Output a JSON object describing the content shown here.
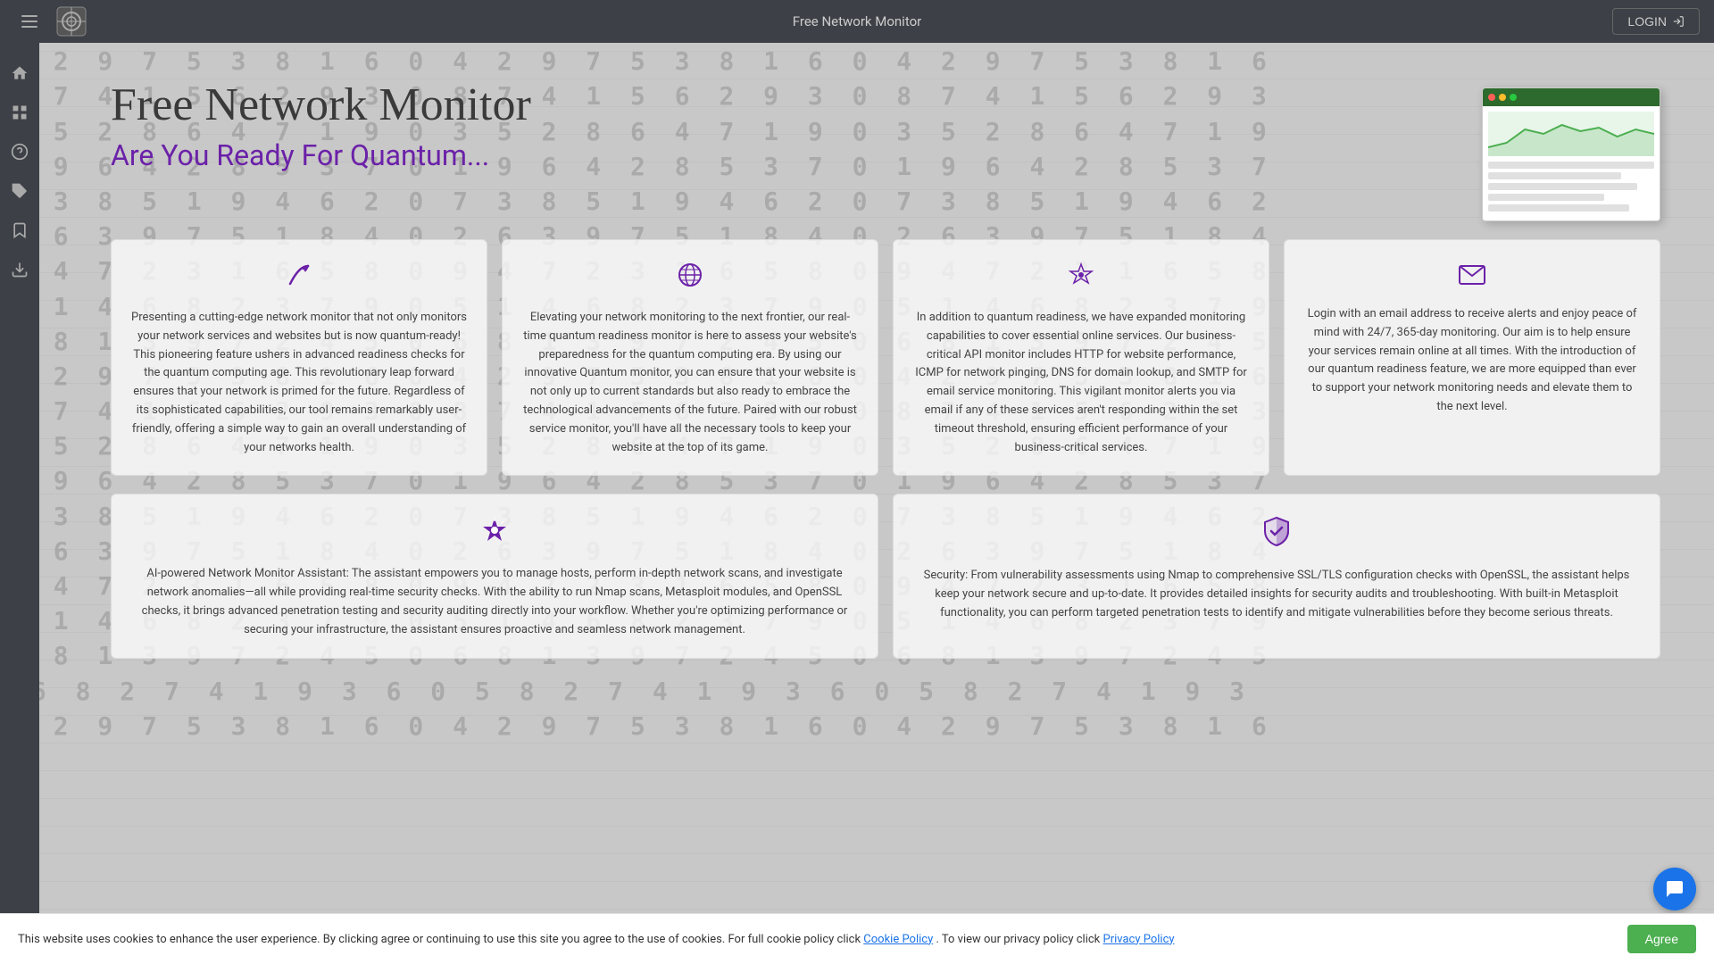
{
  "header": {
    "title": "Free Network Monitor",
    "login_label": "LOGIN"
  },
  "sidebar": {
    "items": [
      {
        "id": "home",
        "icon": "⌂",
        "label": "Home"
      },
      {
        "id": "dashboard",
        "icon": "⊞",
        "label": "Dashboard"
      },
      {
        "id": "help",
        "icon": "?",
        "label": "Help"
      },
      {
        "id": "tags",
        "icon": "⊕",
        "label": "Tags"
      },
      {
        "id": "save",
        "icon": "□",
        "label": "Save"
      },
      {
        "id": "download",
        "icon": "↓",
        "label": "Download"
      }
    ]
  },
  "hero": {
    "title": "Free Network Monitor",
    "subtitle": "Are You Ready For Quantum..."
  },
  "features": [
    {
      "icon": "↙",
      "text": "Presenting a cutting-edge network monitor that not only monitors your network services and websites but is now quantum-ready! This pioneering feature ushers in advanced readiness checks for the quantum computing age. This revolutionary leap forward ensures that your network is primed for the future. Regardless of its sophisticated capabilities, our tool remains remarkably user-friendly, offering a simple way to gain an overall understanding of your networks health."
    },
    {
      "icon": "🌐",
      "text": "Elevating your network monitoring to the next frontier, our real-time quantum readiness monitor is here to assess your website's preparedness for the quantum computing era. By using our innovative Quantum monitor, you can ensure that your website is not only up to current standards but also ready to embrace the technological advancements of the future. Paired with our robust service monitor, you'll have all the necessary tools to keep your website at the top of its game."
    },
    {
      "icon": "✦",
      "text": "In addition to quantum readiness, we have expanded monitoring capabilities to cover essential online services. Our business-critical API monitor includes HTTP for website performance, ICMP for network pinging, DNS for domain lookup, and SMTP for email service monitoring. This vigilant monitor alerts you via email if any of these services aren't responding within the set timeout threshold, ensuring efficient performance of your business-critical services."
    },
    {
      "icon": "✉",
      "text": "Login with an email address to receive alerts and enjoy peace of mind with 24/7, 365-day monitoring. Our aim is to help ensure your services remain online at all times. With the introduction of our quantum readiness feature, we are more equipped than ever to support your network monitoring needs and elevate them to the next level."
    }
  ],
  "features_bottom": [
    {
      "icon": "★",
      "text": "AI-powered Network Monitor Assistant: The assistant empowers you to manage hosts, perform in-depth network scans, and investigate network anomalies—all while providing real-time security checks. With the ability to run Nmap scans, Metasploit modules, and OpenSSL checks, it brings advanced penetration testing and security auditing directly into your workflow. Whether you're optimizing performance or securing your infrastructure, the assistant ensures proactive and seamless network management."
    },
    {
      "icon": "🛡",
      "text": "Security: From vulnerability assessments using Nmap to comprehensive SSL/TLS configuration checks with OpenSSL, the assistant helps keep your network secure and up-to-date. It provides detailed insights for security audits and troubleshooting. With built-in Metasploit functionality, you can perform targeted penetration tests to identify and mitigate vulnerabilities before they become serious threats."
    }
  ],
  "cookie": {
    "text": "This website uses cookies to enhance the user experience. By clicking agree or continuing to use this site you agree to the use of cookies. For full cookie policy click ",
    "cookie_link": "Cookie Policy",
    "privacy_text": ". To view our privacy policy click ",
    "privacy_link": "Privacy Policy",
    "agree_label": "Agree"
  }
}
